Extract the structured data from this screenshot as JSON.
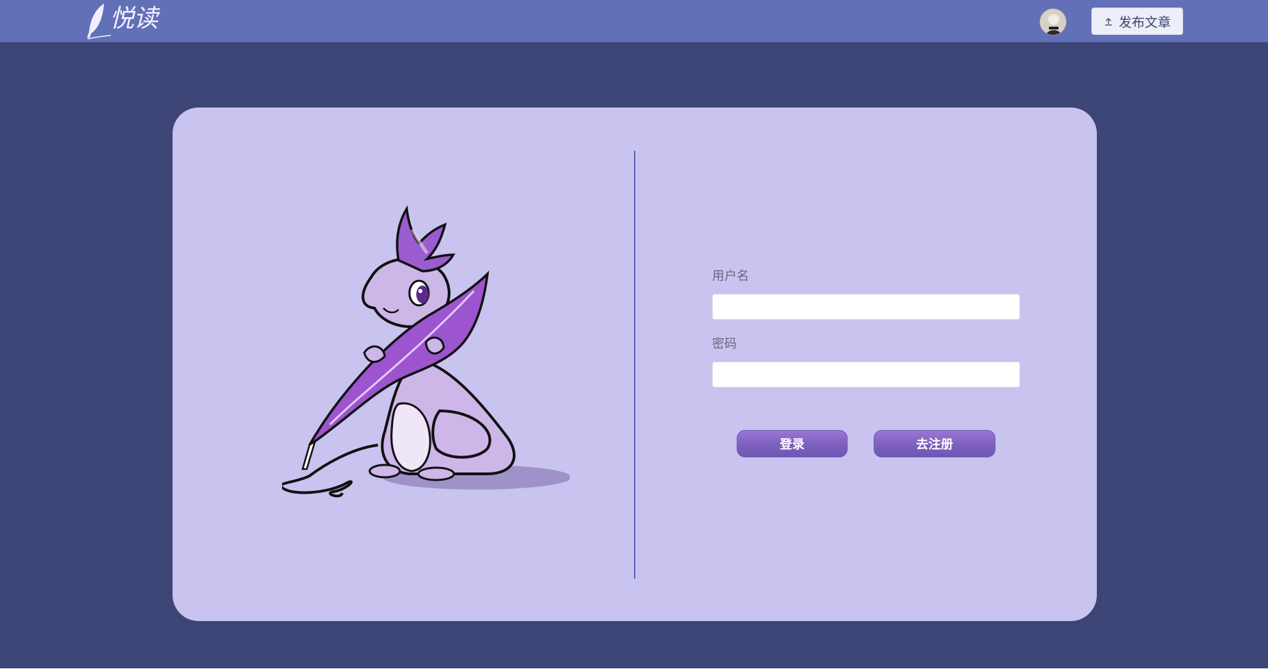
{
  "header": {
    "logo_text": "悦读",
    "publish_label": "发布文章",
    "colors": {
      "bar": "#6270b8",
      "publish_button_bg": "#eceef8"
    }
  },
  "main": {
    "background": "#3d4476",
    "card_background": "#c9c3ef"
  },
  "login_form": {
    "username_label": "用户名",
    "username_value": "",
    "password_label": "密码",
    "password_value": "",
    "login_button": "登录",
    "register_button": "去注册"
  },
  "icons": {
    "logo": "feather-quill-icon",
    "publish": "upload-arrow-icon",
    "avatar": "user-avatar",
    "illustration": "purple-dragon-with-quill"
  }
}
